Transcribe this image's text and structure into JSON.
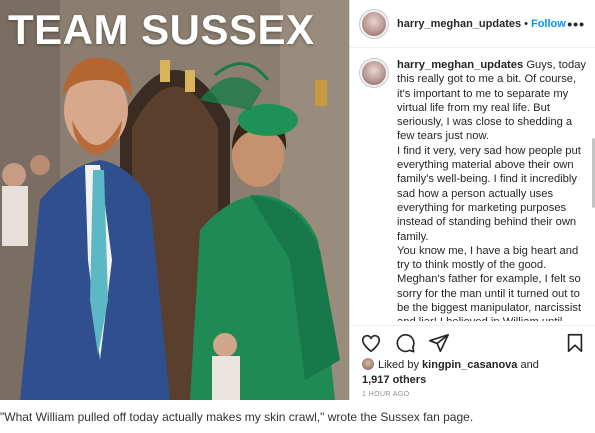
{
  "photo": {
    "overlay_title": "TEAM SUSSEX"
  },
  "post": {
    "username": "harry_meghan_updates",
    "separator": "•",
    "follow_label": "Follow",
    "more_icon": "more-options-icon",
    "caption_paragraphs": [
      "Guys, today this really got to me a bit. Of course, it's important to me to separate my virtual life from my real life. But seriously, I was close to shedding a few tears just now.",
      "I find it very, very sad how people put everything material above their own family's well-being. I find it incredibly sad how a person actually uses everything for marketing purposes instead of standing behind their own family.",
      "You know me, I have a big heart and try to think mostly of the good. Meghan's father for example, I felt so sorry for the man until it turned out to be the biggest manipulator, narcissist and liar! I believed in William until now, and wish"
    ],
    "actions": {
      "like_icon": "heart-icon",
      "comment_icon": "comment-icon",
      "share_icon": "share-icon",
      "save_icon": "bookmark-icon"
    },
    "likes": {
      "prefix": "Liked by",
      "liker": "kingpin_casanova",
      "conjunction": "and",
      "others": "1,917 others"
    },
    "timestamp": "1 HOUR AGO"
  },
  "article_caption": "\"What William pulled off today actually makes my skin crawl,\" wrote the Sussex fan page."
}
